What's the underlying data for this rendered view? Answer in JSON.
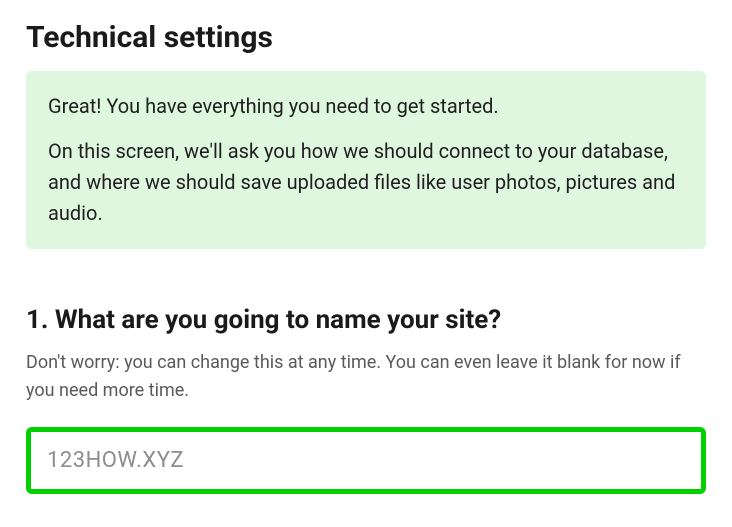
{
  "header": {
    "title": "Technical settings"
  },
  "info": {
    "line1": "Great! You have everything you need to get started.",
    "line2": "On this screen, we'll ask you how we should connect to your database, and where we should save uploaded files like user photos, pictures and audio."
  },
  "question1": {
    "heading": "1. What are you going to name your site?",
    "description": "Don't worry: you can change this at any time. You can even leave it blank for now if you need more time.",
    "placeholder": "123HOW.XYZ",
    "value": ""
  }
}
